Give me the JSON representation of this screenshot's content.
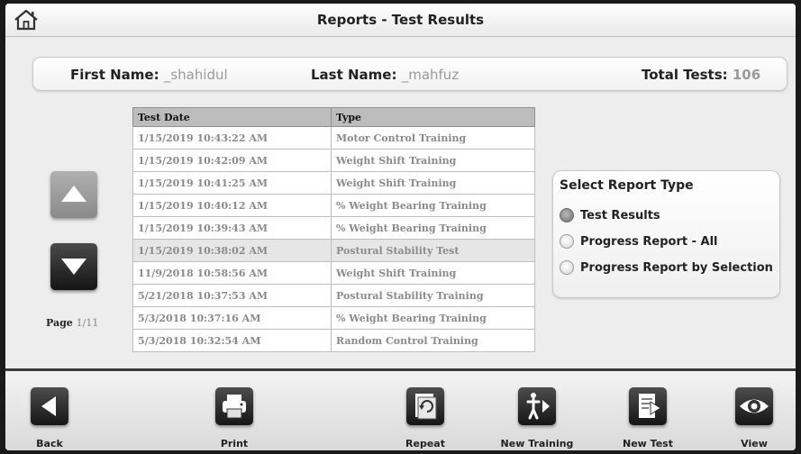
{
  "header": {
    "title": "Reports - Test Results",
    "home_icon": "home-icon"
  },
  "info": {
    "first_name_label": "First Name:",
    "first_name_value": "_shahidul",
    "last_name_label": "Last Name:",
    "last_name_value": "_mahfuz",
    "total_tests_label": "Total Tests:",
    "total_tests_value": "106"
  },
  "pager": {
    "up_icon": "triangle-up-icon",
    "down_icon": "triangle-down-icon",
    "page_label": "Page",
    "page_value": "1/11"
  },
  "table": {
    "headers": [
      "Test Date",
      "Type"
    ],
    "rows": [
      {
        "date": "1/15/2019 10:43:22 AM",
        "type": "Motor Control Training"
      },
      {
        "date": "1/15/2019 10:42:09 AM",
        "type": "Weight Shift Training"
      },
      {
        "date": "1/15/2019 10:41:25 AM",
        "type": "Weight Shift Training"
      },
      {
        "date": "1/15/2019 10:40:12 AM",
        "type": "% Weight Bearing Training"
      },
      {
        "date": "1/15/2019 10:39:43 AM",
        "type": "% Weight Bearing Training"
      },
      {
        "date": "1/15/2019 10:38:02 AM",
        "type": "Postural Stability Test"
      },
      {
        "date": "11/9/2018 10:58:56 AM",
        "type": "Weight Shift Training"
      },
      {
        "date": "5/21/2018 10:37:53 AM",
        "type": "Postural Stability Training"
      },
      {
        "date": "5/3/2018 10:37:16 AM",
        "type": "% Weight Bearing Training"
      },
      {
        "date": "5/3/2018 10:32:54 AM",
        "type": "Random Control Training"
      }
    ],
    "selected_row": 5
  },
  "report_type": {
    "title": "Select Report Type",
    "options": [
      {
        "label": "Test Results",
        "checked": true
      },
      {
        "label": "Progress Report - All",
        "checked": false
      },
      {
        "label": "Progress Report by Selection",
        "checked": false
      }
    ]
  },
  "toolbar": {
    "buttons": [
      {
        "label": "Back",
        "icon": "back-arrow-icon"
      },
      {
        "label": "Print",
        "icon": "printer-icon"
      },
      {
        "label": "Repeat",
        "icon": "repeat-icon"
      },
      {
        "label": "New Training",
        "icon": "training-figure-icon"
      },
      {
        "label": "New Test",
        "icon": "new-test-icon"
      },
      {
        "label": "View",
        "icon": "eye-icon"
      }
    ]
  }
}
